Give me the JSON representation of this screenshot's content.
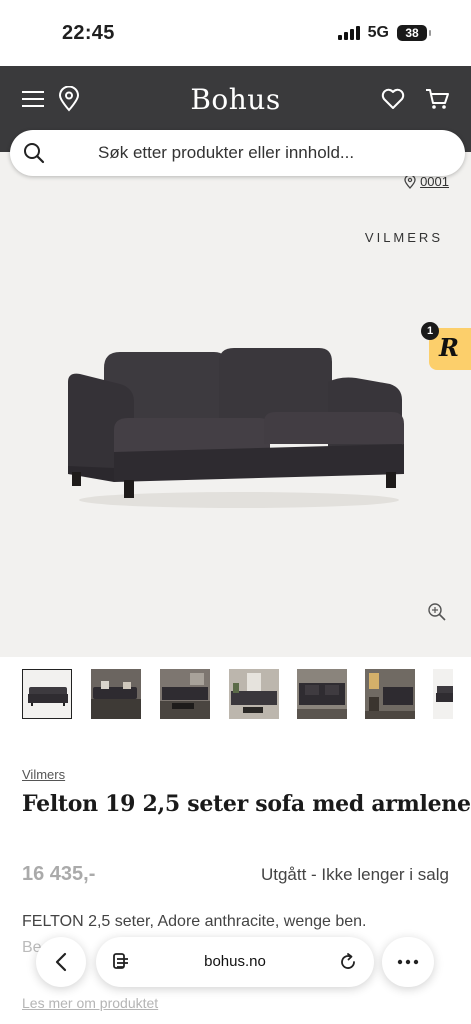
{
  "status_bar": {
    "time": "22:45",
    "network": "5G",
    "battery": "38"
  },
  "header": {
    "logo": "Bohus"
  },
  "search": {
    "placeholder": "Søk etter produkter eller innhold..."
  },
  "gallery": {
    "store_label": "0001",
    "brand_tag": "VILMERS",
    "rewards_letter": "R",
    "rewards_count": "1"
  },
  "product": {
    "brand": "Vilmers",
    "title": "Felton 19 2,5 seter sofa med armlene",
    "price": "16 435,-",
    "availability": "Utgått - Ikke lenger i salg",
    "description": "FELTON 2,5 seter, Adore anthracite, wenge ben.",
    "description_partial": "Be",
    "read_more": "Les mer om produktet"
  },
  "browser": {
    "url": "bohus.no"
  },
  "colors": {
    "header_bg": "#3a3a3c",
    "rewards_badge": "#fccf6b",
    "gallery_bg": "#f2f1ef"
  }
}
